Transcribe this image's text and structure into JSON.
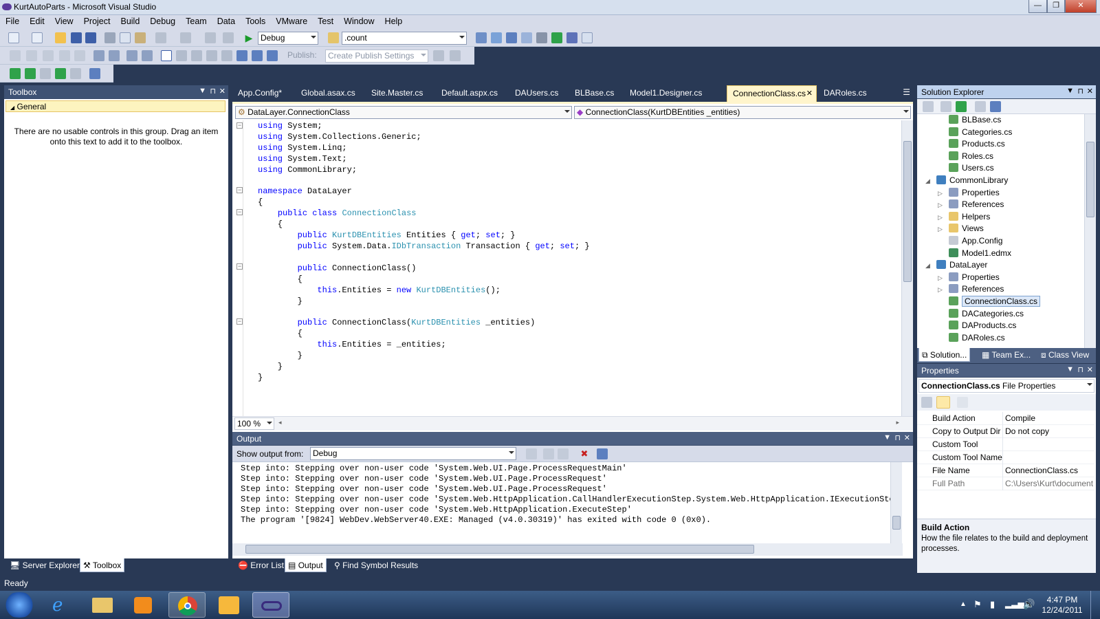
{
  "window": {
    "title": "KurtAutoParts - Microsoft Visual Studio",
    "minimize": "—",
    "restore": "❐",
    "close": "✕"
  },
  "menu": [
    "File",
    "Edit",
    "View",
    "Project",
    "Build",
    "Debug",
    "Team",
    "Data",
    "Tools",
    "VMware",
    "Test",
    "Window",
    "Help"
  ],
  "toolbar": {
    "config": "Debug",
    "find": ".count",
    "publish_label": "Publish:",
    "publish_combo": "Create Publish Settings"
  },
  "toolbox": {
    "title": "Toolbox",
    "group": "General",
    "empty_line1": "There are no usable controls in this group. Drag an item",
    "empty_line2": "onto this text to add it to the toolbox."
  },
  "left_bottom_tabs": [
    "Server Explorer",
    "Toolbox"
  ],
  "editor": {
    "tabs": [
      "App.Config*",
      "Global.asax.cs",
      "Site.Master.cs",
      "Default.aspx.cs",
      "DAUsers.cs",
      "BLBase.cs",
      "Model1.Designer.cs",
      "ConnectionClass.cs",
      "DARoles.cs"
    ],
    "active_tab": "ConnectionClass.cs",
    "type_nav": "DataLayer.ConnectionClass",
    "member_nav": "ConnectionClass(KurtDBEntities _entities)",
    "zoom": "100 %",
    "code_lines": [
      "using System;",
      "using System.Collections.Generic;",
      "using System.Linq;",
      "using System.Text;",
      "using CommonLibrary;",
      "",
      "namespace DataLayer",
      "{",
      "    public class ConnectionClass",
      "    {",
      "        public KurtDBEntities Entities { get; set; }",
      "        public System.Data.IDbTransaction Transaction { get; set; }",
      "",
      "        public ConnectionClass()",
      "        {",
      "            this.Entities = new KurtDBEntities();",
      "        }",
      "",
      "        public ConnectionClass(KurtDBEntities _entities)",
      "        {",
      "            this.Entities = _entities;",
      "        }",
      "    }",
      "}"
    ]
  },
  "output": {
    "title": "Output",
    "show_from_label": "Show output from:",
    "show_from_value": "Debug",
    "lines": [
      "Step into: Stepping over non-user code 'System.Web.UI.Page.ProcessRequestMain'",
      "Step into: Stepping over non-user code 'System.Web.UI.Page.ProcessRequest'",
      "Step into: Stepping over non-user code 'System.Web.UI.Page.ProcessRequest'",
      "Step into: Stepping over non-user code 'System.Web.HttpApplication.CallHandlerExecutionStep.System.Web.HttpApplication.IExecutionStep.Exe",
      "Step into: Stepping over non-user code 'System.Web.HttpApplication.ExecuteStep'",
      "The program '[9824] WebDev.WebServer40.EXE: Managed (v4.0.30319)' has exited with code 0 (0x0)."
    ]
  },
  "bottom_tabs": [
    "Error List",
    "Output",
    "Find Symbol Results"
  ],
  "solution_explorer": {
    "title": "Solution Explorer",
    "items": [
      {
        "label": "BLBase.cs",
        "indent": 2
      },
      {
        "label": "Categories.cs",
        "indent": 2
      },
      {
        "label": "Products.cs",
        "indent": 2
      },
      {
        "label": "Roles.cs",
        "indent": 2
      },
      {
        "label": "Users.cs",
        "indent": 2
      },
      {
        "label": "CommonLibrary",
        "indent": 1
      },
      {
        "label": "Properties",
        "indent": 2
      },
      {
        "label": "References",
        "indent": 2
      },
      {
        "label": "Helpers",
        "indent": 2
      },
      {
        "label": "Views",
        "indent": 2
      },
      {
        "label": "App.Config",
        "indent": 2
      },
      {
        "label": "Model1.edmx",
        "indent": 2
      },
      {
        "label": "DataLayer",
        "indent": 1
      },
      {
        "label": "Properties",
        "indent": 2
      },
      {
        "label": "References",
        "indent": 2
      },
      {
        "label": "ConnectionClass.cs",
        "indent": 2
      },
      {
        "label": "DACategories.cs",
        "indent": 2
      },
      {
        "label": "DAProducts.cs",
        "indent": 2
      },
      {
        "label": "DARoles.cs",
        "indent": 2
      }
    ],
    "tabs": [
      "Solution...",
      "Team Ex...",
      "Class View"
    ]
  },
  "properties": {
    "title": "Properties",
    "object_name": "ConnectionClass.cs",
    "object_type": "File Properties",
    "rows": [
      {
        "key": "Build Action",
        "value": "Compile"
      },
      {
        "key": "Copy to Output Dir",
        "value": "Do not copy"
      },
      {
        "key": "Custom Tool",
        "value": ""
      },
      {
        "key": "Custom Tool Name",
        "value": ""
      },
      {
        "key": "File Name",
        "value": "ConnectionClass.cs"
      },
      {
        "key": "Full Path",
        "value": "C:\\Users\\Kurt\\document"
      }
    ],
    "desc_title": "Build Action",
    "desc_text": "How the file relates to the build and deployment processes."
  },
  "status": "Ready",
  "clock": {
    "time": "4:47 PM",
    "date": "12/24/2011"
  }
}
